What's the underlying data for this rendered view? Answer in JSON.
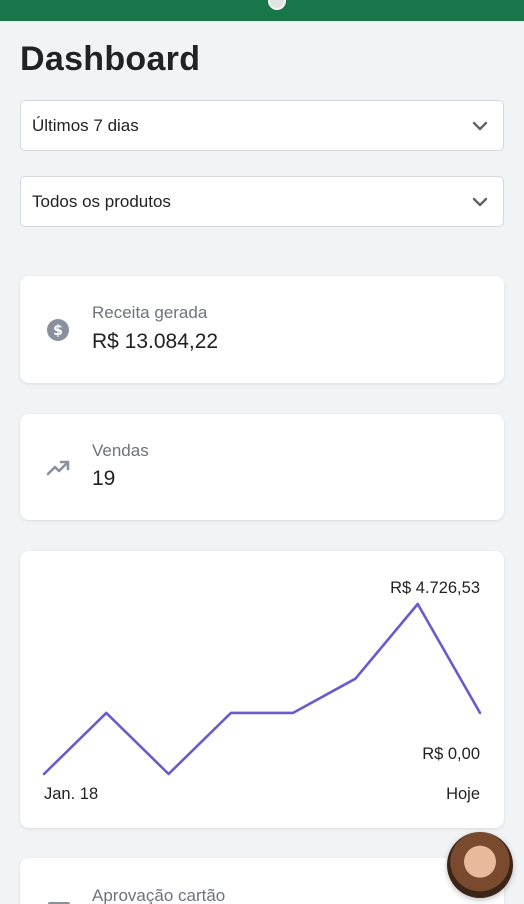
{
  "header": {
    "title": "Dashboard"
  },
  "filters": {
    "period": {
      "value": "Últimos 7 dias"
    },
    "product": {
      "value": "Todos os produtos"
    }
  },
  "stats": [
    {
      "label": "Receita gerada",
      "value": "R$  13.084,22",
      "icon": "dollar-circle-icon"
    },
    {
      "label": "Vendas",
      "value": "19",
      "icon": "trending-up-icon"
    },
    {
      "label": "Aprovação cartão",
      "icon": "card-icon"
    }
  ],
  "chart": {
    "max_label": "R$  4.726,53",
    "min_label": "R$  0,00",
    "x_start_label": "Jan. 18",
    "x_end_label": "Hoje"
  },
  "chart_data": {
    "type": "line",
    "x": [
      "Jan. 18",
      "",
      "",
      "",
      "",
      "",
      "",
      "Hoje"
    ],
    "values": [
      0,
      1700,
      0,
      1700,
      1700,
      2650,
      4726.53,
      1700
    ],
    "ylim": [
      0,
      4726.53
    ],
    "color": "#6a5acd"
  },
  "colors": {
    "brand": "#19764a",
    "line": "#6a5acd"
  }
}
